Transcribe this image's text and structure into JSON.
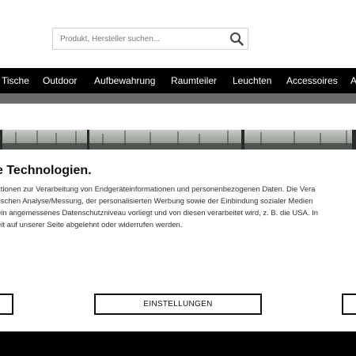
{
  "search": {
    "placeholder": "Produkt, Hersteller suchen..."
  },
  "nav": {
    "items": [
      {
        "label": "Tische"
      },
      {
        "label": "Outdoor"
      },
      {
        "label": "Aufbewahrung"
      },
      {
        "label": "Raumteiler"
      },
      {
        "label": "Leuchten"
      },
      {
        "label": "Accessoires"
      },
      {
        "label": "A"
      }
    ]
  },
  "cookie_banner": {
    "title": "e Technologien.",
    "text_lines": [
      "ktionen zur Verarbeitung von Endgeräteinformationen und personenbezogenen Daten. Die Vera",
      "tischen Analyse/Messung, der personalisierten Werbung sowie der Einbindung sozialer Medien",
      "ein angemessenes Datenschutzniveau vorliegt und von diesen verarbeitet wird, z. B. die USA. In",
      "eit auf unserer Seite abgelehnt oder widerrufen werden."
    ],
    "settings_button": "EINSTELLUNGEN"
  },
  "colors": {
    "nav_background": "#000000",
    "subbar": "#6b6b6b",
    "footer": "#000000"
  }
}
